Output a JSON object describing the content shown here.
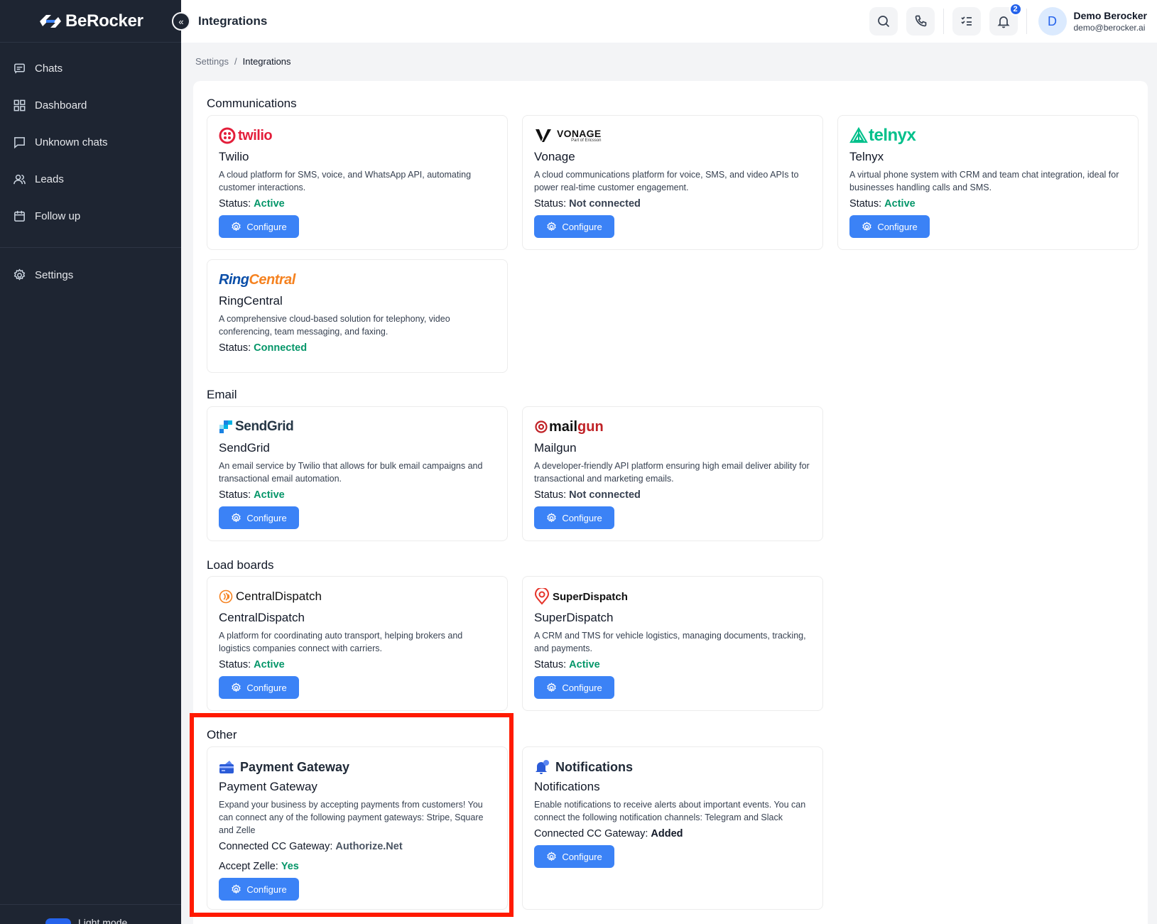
{
  "app": {
    "name": "BeRocker"
  },
  "sidebar": {
    "items": [
      {
        "label": "Chats",
        "icon": "chat-icon"
      },
      {
        "label": "Dashboard",
        "icon": "grid-icon"
      },
      {
        "label": "Unknown chats",
        "icon": "message-square-icon"
      },
      {
        "label": "Leads",
        "icon": "users-icon"
      },
      {
        "label": "Follow up",
        "icon": "calendar-icon"
      }
    ],
    "settings_label": "Settings",
    "mode_label": "Light mode"
  },
  "header": {
    "title": "Integrations",
    "notification_count": "2",
    "user": {
      "initial": "D",
      "name": "Demo Berocker",
      "email": "demo@berocker.ai"
    }
  },
  "breadcrumb": {
    "parent": "Settings",
    "separator": "/",
    "current": "Integrations"
  },
  "sections": {
    "communications": "Communications",
    "email": "Email",
    "load_boards": "Load boards",
    "other": "Other"
  },
  "status_label": "Status:",
  "configure_label": "Configure",
  "cards": {
    "twilio": {
      "logo": "twilio",
      "name": "Twilio",
      "desc": "A cloud platform for SMS, voice, and WhatsApp API, automating customer interactions.",
      "status": "Active"
    },
    "vonage": {
      "logo": "VONAGE",
      "logo_sub": "Part of Ericsson",
      "name": "Vonage",
      "desc": "A cloud communications platform for voice, SMS, and video APIs to power real-time customer engagement.",
      "status": "Not connected"
    },
    "telnyx": {
      "logo": "telnyx",
      "name": "Telnyx",
      "desc": "A virtual phone system with CRM and team chat integration, ideal for businesses handling calls and SMS.",
      "status": "Active"
    },
    "ringcentral": {
      "logo_a": "Ring",
      "logo_b": "Central",
      "name": "RingCentral",
      "desc": "A comprehensive cloud-based solution for telephony, video conferencing, team messaging, and faxing.",
      "status": "Connected"
    },
    "sendgrid": {
      "logo": "SendGrid",
      "name": "SendGrid",
      "desc": "An email service by Twilio that allows for bulk email campaigns and transactional email automation.",
      "status": "Active"
    },
    "mailgun": {
      "logo_a": "mail",
      "logo_b": "gun",
      "name": "Mailgun",
      "desc": "A developer-friendly API platform ensuring high email deliver ability for transactional and marketing emails.",
      "status": "Not connected"
    },
    "centraldispatch": {
      "logo": "CentralDispatch",
      "name": "CentralDispatch",
      "desc": "A platform for coordinating auto transport, helping brokers and logistics companies connect with carriers.",
      "status": "Active"
    },
    "superdispatch": {
      "logo": "SuperDispatch",
      "name": "SuperDispatch",
      "desc": "A CRM and TMS for vehicle logistics, managing documents, tracking, and payments.",
      "status": "Active"
    },
    "payment": {
      "logo": "Payment Gateway",
      "name": "Payment Gateway",
      "desc": "Expand your business by accepting payments from customers! You can connect any of the following payment gateways: Stripe, Square and Zelle",
      "gateway_label": "Connected CC Gateway:",
      "gateway_value": "Authorize.Net",
      "zelle_label": "Accept Zelle:",
      "zelle_value": "Yes"
    },
    "notifications": {
      "logo": "Notifications",
      "name": "Notifications",
      "desc": "Enable notifications to receive alerts about important events. You can connect the following notification channels: Telegram and Slack",
      "gateway_label": "Connected CC Gateway:",
      "gateway_value": "Added"
    }
  },
  "colors": {
    "sidebar_bg": "#1e2532",
    "accent": "#3b82f6",
    "status_green": "#059669",
    "highlight": "#ff1a00"
  }
}
